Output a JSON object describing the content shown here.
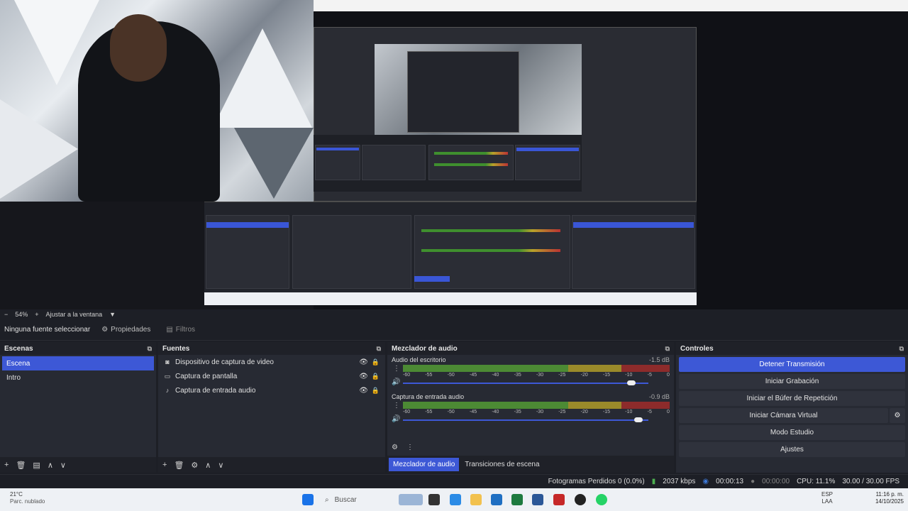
{
  "zoom": {
    "percent_label": "54%",
    "fit_label": "Ajustar a la ventana"
  },
  "source_toolbar": {
    "no_source_label": "Ninguna fuente seleccionar",
    "properties_label": "Propiedades",
    "filters_label": "Filtros"
  },
  "scenes": {
    "title": "Escenas",
    "items": [
      "Escena",
      "Intro"
    ],
    "selected": "Escena"
  },
  "sources": {
    "title": "Fuentes",
    "items": [
      {
        "label": "Dispositivo de captura de video",
        "icon": "camera-icon"
      },
      {
        "label": "Captura de pantalla",
        "icon": "monitor-icon"
      },
      {
        "label": "Captura de entrada audio",
        "icon": "microphone-icon"
      }
    ]
  },
  "mixer": {
    "title": "Mezclador de audio",
    "tracks": [
      {
        "name": "Audio del escritorio",
        "db": "-1.5 dB",
        "level": 0.93
      },
      {
        "name": "Captura de entrada audio",
        "db": "-0.9 dB",
        "level": 0.96
      }
    ],
    "scale": [
      "-60",
      "-55",
      "-50",
      "-45",
      "-40",
      "-35",
      "-30",
      "-25",
      "-20",
      "-15",
      "-10",
      "-5",
      "0"
    ],
    "tabs": [
      "Mezclador de audio",
      "Transiciones de escena"
    ]
  },
  "controls": {
    "title": "Controles",
    "buttons": [
      {
        "label": "Detener Transmisión",
        "active": true
      },
      {
        "label": "Iniciar Grabación",
        "active": false
      },
      {
        "label": "Iniciar el Búfer de Repetición",
        "active": false
      },
      {
        "label": "Iniciar Cámara Virtual",
        "active": false
      },
      {
        "label": "Modo Estudio",
        "active": false
      },
      {
        "label": "Ajustes",
        "active": false
      }
    ]
  },
  "status": {
    "dropped": "Fotogramas Perdidos 0 (0.0%)",
    "bitrate": "2037 kbps",
    "stream_time": "00:00:13",
    "rec_time": "00:00:00",
    "cpu": "CPU: 11.1%",
    "fps": "30.00 / 30.00 FPS"
  },
  "taskbar": {
    "weather_temp": "21°C",
    "weather_desc": "Parc. nublado",
    "search_placeholder": "Buscar",
    "lang_top": "ESP",
    "lang_bottom": "LAA",
    "time": "11:16 p. m.",
    "date": "14/10/2025",
    "accent": "#0078d4"
  },
  "colors": {
    "accent": "#3d58d6",
    "panel": "#272a33",
    "background": "#1d1f26"
  }
}
